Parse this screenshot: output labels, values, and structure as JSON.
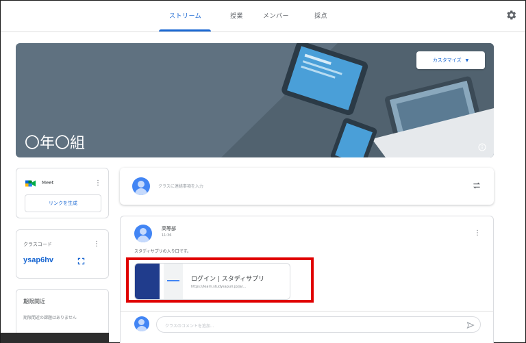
{
  "nav": {
    "tabs": [
      {
        "label": "ストリーム",
        "active": true
      },
      {
        "label": "授業",
        "active": false
      },
      {
        "label": "メンバー",
        "active": false
      },
      {
        "label": "採点",
        "active": false
      }
    ],
    "settings_icon": "gear-icon"
  },
  "banner": {
    "title": "〇年〇組",
    "customize_label": "カスタマイズ",
    "info_icon": "info-icon",
    "background_color": "#5f7180"
  },
  "meet": {
    "label": "Meet",
    "link_button": "リンクを生成"
  },
  "class_code": {
    "label": "クラスコード",
    "value": "ysap6hv",
    "expand_icon": "fullscreen-icon"
  },
  "upcoming": {
    "label": "期限間近",
    "text": "期限間近の課題はありません"
  },
  "announce": {
    "placeholder": "クラスに連絡事項を入力"
  },
  "post": {
    "author": "高等部",
    "time": "11:36",
    "body": "スタディサプリの入り口です。",
    "attachment": {
      "title": "ログイン | スタディサプリ",
      "url": "https://learn.studysapuri.jp/ja/..."
    },
    "comment_placeholder": "クラスのコメントを追加..."
  },
  "colors": {
    "accent": "#1967d2",
    "highlight": "#e00000",
    "avatar": "#4285f4"
  }
}
